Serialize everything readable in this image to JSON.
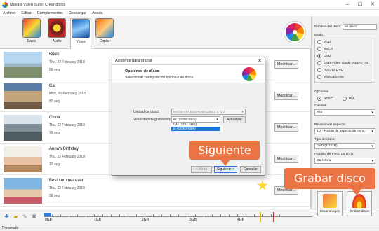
{
  "titlebar": {
    "title": "Movavi Video Suite: Crear disco"
  },
  "menu": [
    "Archivo",
    "Editar",
    "Complementos",
    "Descargar",
    "Ayuda"
  ],
  "toolbar": {
    "tabs": [
      "Datos",
      "Audio",
      "Vídeo",
      "Copiar"
    ],
    "active_tab": "Vídeo"
  },
  "videos": [
    {
      "name": "Bikes",
      "date": "Thu, 22 February 2018",
      "duration": "89 seg"
    },
    {
      "name": "Cat",
      "date": "Mon, 26 February 2018",
      "duration": "87 seg"
    },
    {
      "name": "China",
      "date": "Thu, 22 February 2018",
      "duration": "79 seg"
    },
    {
      "name": "Anna's Birthday",
      "date": "Thu, 22 February 2018",
      "duration": "12 seg"
    },
    {
      "name": "Best summer ever",
      "date": "Thu, 22 February 2018",
      "duration": "88 seg"
    }
  ],
  "modify_label": "Modificar...",
  "side": {
    "disc_name_label": "Nombre del disco:",
    "disc_name_value": "Mi disco",
    "mode_label": "Modo",
    "modes": [
      "VCD",
      "SVCD",
      "DVD",
      "DVD-Vídeo desde VIDEO_TS",
      "AVCHD DVD",
      "Vídeo Blu-ray"
    ],
    "selected_mode": "DVD",
    "options_label": "Opciones",
    "ntsc": "NTSC",
    "pal": "PAL",
    "quality_label": "Calidad:",
    "quality_value": "Alto",
    "aspect_label": "Relación de aspecto:",
    "aspect_value": "4:3 - Razón de aspecto de TV e...",
    "disc_type_label": "Tipo de disco:",
    "disc_type_value": "DVD (4.7 GB)",
    "menu_template_label": "Plantilla de menú de DVD:",
    "menu_template_value": "Carretera"
  },
  "ruler": {
    "labels": [
      "0GB",
      "1GB",
      "2GB",
      "3GB",
      "4GB"
    ],
    "used_fraction": 0.03
  },
  "bottom_buttons": {
    "create_image": "Crear imagen",
    "burn": "Grabar disco"
  },
  "status": "Preparado",
  "dialog": {
    "title": "Asistente para grabar",
    "heading": "Opciones de disco",
    "subheading": "Seleccionar configuración opcional de disco",
    "drive_label": "Unidad de disco:",
    "drive_value": "MATSHITA DVD-RAM UJ8E2 S (D:)",
    "speed_label": "Velocidad de grabación:",
    "speed_value": "8x (11080 KB/s)",
    "speed_options": [
      "2.4x (3324 KB/s)",
      "8x (11080 KB/s)"
    ],
    "refresh": "Actualizar",
    "back": "< Atrás",
    "next": "Siguiente >",
    "cancel": "Cancelar"
  },
  "callouts": {
    "next": "Siguiente",
    "burn": "Grabar disco"
  }
}
